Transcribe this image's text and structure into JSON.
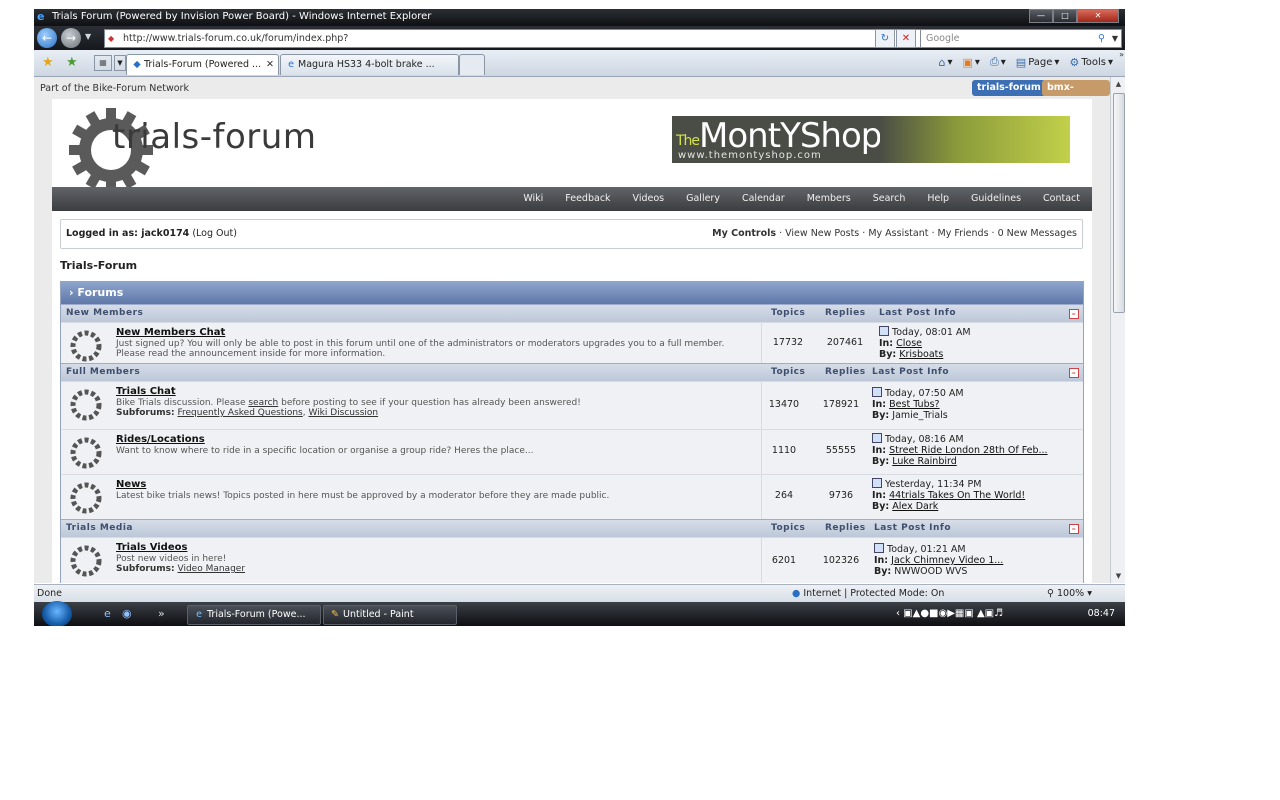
{
  "browser": {
    "window_title": "Trials Forum (Powered by Invision Power Board) - Windows Internet Explorer",
    "address": "http://www.trials-forum.co.uk/forum/index.php?",
    "search_placeholder": "Google",
    "tabs": [
      {
        "label": "Trials-Forum (Powered ...",
        "active": true
      },
      {
        "label": "Magura HS33 4-bolt brake ...",
        "active": false
      }
    ],
    "commands": {
      "page": "Page",
      "tools": "Tools"
    },
    "status_done": "Done",
    "zone": "Internet | Protected Mode: On",
    "zoom": "100%"
  },
  "site": {
    "network_text": "Part of the Bike-Forum Network",
    "network_logos": [
      "trials-forum",
      "bmx-forum"
    ],
    "logo_text": "trials-forum",
    "ad": {
      "prefix": "The",
      "name": "MontYShop",
      "url": "www.themontyshop.com"
    },
    "nav": [
      "Wiki",
      "Feedback",
      "Videos",
      "Gallery",
      "Calendar",
      "Members",
      "Search",
      "Help",
      "Guidelines",
      "Contact"
    ],
    "user": {
      "logged_in_text": "Logged in as: jack0174",
      "logout": "(Log Out)",
      "my_controls": "My Controls",
      "links": [
        "View New Posts",
        "My Assistant",
        "My Friends",
        "0 New Messages"
      ]
    },
    "breadcrumb": "Trials-Forum",
    "forums_header": "Forums",
    "col_topics": "Topics",
    "col_replies": "Replies",
    "col_last": "Last Post Info"
  },
  "categories": [
    {
      "name": "New Members",
      "forums": [
        {
          "name": "New Members Chat",
          "desc": "Just signed up? You will only be able to post in this forum until one of the administrators or moderators upgrades you to a full member. Please read the announcement inside for more information.",
          "subforums": [],
          "topics": "17732",
          "replies": "207461",
          "last_time": "Today, 08:01 AM",
          "last_in": "Close",
          "last_by": "Krisboats"
        }
      ]
    },
    {
      "name": "Full Members",
      "forums": [
        {
          "name": "Trials Chat",
          "desc_pre": "Bike Trials discussion. Please ",
          "desc_link": "search",
          "desc_post": " before posting to see if your question has already been answered!",
          "subforums_label": "Subforums:",
          "subforums": [
            "Frequently Asked Questions",
            "Wiki Discussion"
          ],
          "topics": "13470",
          "replies": "178921",
          "last_time": "Today, 07:50 AM",
          "last_in": "Best Tubs?",
          "last_by": "Jamie_Trials"
        },
        {
          "name": "Rides/Locations",
          "desc": "Want to know where to ride in a specific location or organise a group ride? Heres the place...",
          "topics": "1110",
          "replies": "55555",
          "last_time": "Today, 08:16 AM",
          "last_in": "Street Ride London 28th Of Feb...",
          "last_by": "Luke Rainbird"
        },
        {
          "name": "News",
          "desc": "Latest bike trials news! Topics posted in here must be approved by a moderator before they are made public.",
          "topics": "264",
          "replies": "9736",
          "last_time": "Yesterday, 11:34 PM",
          "last_in": "44trials Takes On The World!",
          "last_by": "Alex Dark"
        }
      ]
    },
    {
      "name": "Trials Media",
      "forums": [
        {
          "name": "Trials Videos",
          "desc": "Post new videos in here!",
          "subforums_label": "Subforums:",
          "subforums": [
            "Video Manager"
          ],
          "topics": "6201",
          "replies": "102326",
          "last_time": "Today, 01:21 AM",
          "last_in": "Jack Chimney Video 1...",
          "last_by": "NWWOOD WVS"
        }
      ]
    }
  ],
  "taskbar": {
    "buttons": [
      "Trials-Forum (Powe...",
      "Untitled - Paint"
    ],
    "clock": "08:47"
  }
}
